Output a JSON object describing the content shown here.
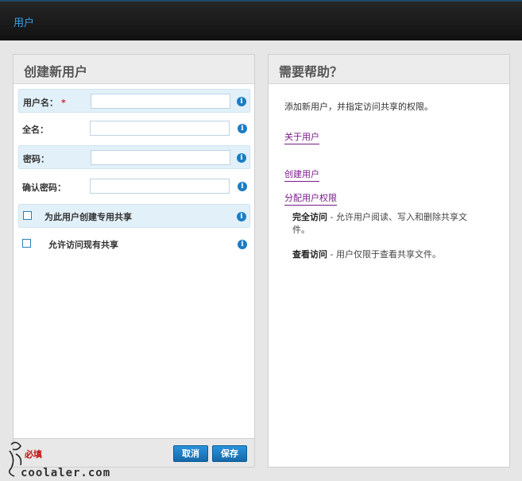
{
  "header": {
    "title": "用户"
  },
  "left_panel": {
    "title": "创建新用户",
    "fields": {
      "username": {
        "label": "用户名：",
        "required_mark": "*",
        "value": ""
      },
      "fullname": {
        "label": "全名：",
        "value": ""
      },
      "password": {
        "label": "密码：",
        "value": ""
      },
      "confirm_password": {
        "label": "确认密码：",
        "value": ""
      }
    },
    "checkboxes": {
      "create_share": {
        "label": "为此用户创建专用共享",
        "checked": false
      },
      "allow_access": {
        "label": "允许访问现有共享",
        "checked": false
      }
    },
    "footer": {
      "required_note": "必填",
      "cancel_label": "取消",
      "save_label": "保存"
    }
  },
  "right_panel": {
    "title": "需要帮助？",
    "intro": "添加新用户，并指定访问共享的权限。",
    "links": {
      "about_users": "关于用户",
      "create_user": "创建用户",
      "assign_permissions": "分配用户权限"
    },
    "permissions": {
      "full_access_term": "完全访问",
      "full_access_desc": " - 允许用户阅读、写入和删除共享文件。",
      "view_access_term": "查看访问",
      "view_access_desc": " - 用户仅限于查看共享文件。"
    }
  },
  "icons": {
    "info": "info-icon",
    "checkbox": "checkbox-icon"
  },
  "watermark": {
    "text": "coolaler.com"
  },
  "colors": {
    "accent": "#1a7dc5",
    "header_title": "#3b9fe6",
    "required": "#d9232d",
    "link": "#7a1a8a"
  }
}
